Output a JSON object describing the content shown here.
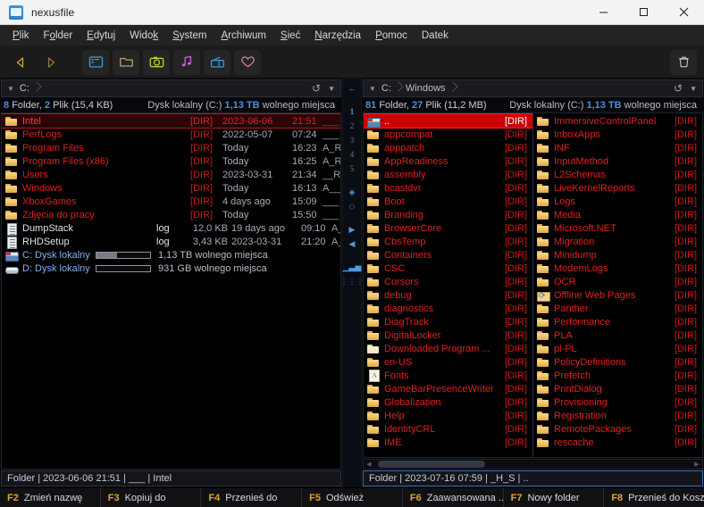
{
  "window": {
    "title": "nexusfile",
    "icon": "app-window-icon",
    "controls": {
      "minimize": "minimize-icon",
      "maximize": "maximize-icon",
      "close": "close-icon"
    }
  },
  "menubar": [
    {
      "label": "Plik",
      "accel": "P"
    },
    {
      "label": "Folder",
      "accel": "o"
    },
    {
      "label": "Edytuj",
      "accel": "E"
    },
    {
      "label": "Widok",
      "accel": "k"
    },
    {
      "label": "System",
      "accel": "S"
    },
    {
      "label": "Archiwum",
      "accel": "A"
    },
    {
      "label": "Sieć",
      "accel": "S"
    },
    {
      "label": "Narzędzia",
      "accel": "N"
    },
    {
      "label": "Pomoc",
      "accel": "P"
    },
    {
      "label": "Datek",
      "accel": ""
    }
  ],
  "toolbar": {
    "back": "back-arrow-icon",
    "forward": "forward-arrow-icon",
    "terminal": "terminal-icon",
    "folder": "folder-icon",
    "camera": "camera-icon",
    "music": "music-note-icon",
    "radio": "radio-icon",
    "favorites": "heart-icon",
    "trash": "trash-icon"
  },
  "rail": {
    "back": "left-arrow-icon",
    "tabs": [
      "1",
      "2",
      "3",
      "4",
      "5"
    ],
    "bookmark_filled": "diamond-filled-icon",
    "bookmark_empty": "diamond-outline-icon",
    "next": "play-right-icon",
    "prev": "play-left-icon",
    "chart": "bar-chart-icon",
    "grid": "grid-icon"
  },
  "left_pane": {
    "path": {
      "caret": "dropdown-caret-icon",
      "crumbs": [
        "C:"
      ],
      "refresh": "refresh-icon",
      "history": "history-caret-icon"
    },
    "stats": {
      "folders": "8",
      "folders_label": "Folder,",
      "files": "2",
      "files_label": "Plik (15,4 KB)"
    },
    "disk_info_prefix": "Dysk lokalny (C:)",
    "disk_info_size": "1,13 TB",
    "disk_info_suffix": "wolnego miejsca",
    "rows": [
      {
        "icon": "folder",
        "name": "Intel",
        "dir": "[DIR]",
        "date": "2023-06-06",
        "time": "21:51",
        "attr": "___",
        "selected": true
      },
      {
        "icon": "folder",
        "name": "PerfLogs",
        "dir": "[DIR]",
        "date": "2022-05-07",
        "time": "07:24",
        "attr": "___",
        "selected": false
      },
      {
        "icon": "folder",
        "name": "Program Files",
        "dir": "[DIR]",
        "date": "Today",
        "time": "16:23",
        "attr": "A_R_",
        "selected": false
      },
      {
        "icon": "folder",
        "name": "Program Files (x86)",
        "dir": "[DIR]",
        "date": "Today",
        "time": "16:25",
        "attr": "A_R_",
        "selected": false
      },
      {
        "icon": "folder",
        "name": "Users",
        "dir": "[DIR]",
        "date": "2023-03-31",
        "time": "21:34",
        "attr": "__R_",
        "selected": false
      },
      {
        "icon": "folder",
        "name": "Windows",
        "dir": "[DIR]",
        "date": "Today",
        "time": "16:13",
        "attr": "A___",
        "selected": false
      },
      {
        "icon": "folder",
        "name": "XboxGames",
        "dir": "[DIR]",
        "date": "4 days ago",
        "time": "15:09",
        "attr": "___",
        "selected": false
      },
      {
        "icon": "folder",
        "name": "Zdjęcia do pracy",
        "dir": "[DIR]",
        "date": "Today",
        "time": "15:50",
        "attr": "___",
        "selected": false
      },
      {
        "icon": "file",
        "name": "DumpStack",
        "type": "log",
        "size": "12,0 KB",
        "date": "19 days ago",
        "time": "09:10",
        "attr": "A___",
        "white": true
      },
      {
        "icon": "file",
        "name": "RHDSetup",
        "type": "log",
        "size": "3,43 KB",
        "date": "2023-03-31",
        "time": "21:20",
        "attr": "A___",
        "white": true
      }
    ],
    "drives": [
      {
        "icon": "drive",
        "name": "C: Dysk lokalny",
        "used_pct": 38,
        "free": "1,13 TB wolnego miejsca"
      },
      {
        "icon": "dvd",
        "name": "D: Dysk lokalny",
        "used_pct": 0,
        "free": "931 GB wolnego miejsca"
      }
    ],
    "status": "Folder  |  2023-06-06 21:51  |  ___  |  Intel"
  },
  "right_pane": {
    "path": {
      "caret": "dropdown-caret-icon",
      "crumbs": [
        "C:",
        "Windows"
      ],
      "refresh": "refresh-icon",
      "history": "history-caret-icon"
    },
    "stats": {
      "folders": "81",
      "folders_label": "Folder,",
      "files": "27",
      "files_label": "Plik (11,2 MB)"
    },
    "disk_info_prefix": "Dysk lokalny (C:)",
    "disk_info_size": "1,13 TB",
    "disk_info_suffix": "wolnego miejsca",
    "column_a": [
      {
        "icon": "up",
        "name": "..",
        "dir": "[DIR]",
        "selected": true
      },
      {
        "icon": "folder",
        "name": "appcompat",
        "dir": "[DIR]"
      },
      {
        "icon": "folder",
        "name": "apppatch",
        "dir": "[DIR]"
      },
      {
        "icon": "folder",
        "name": "AppReadiness",
        "dir": "[DIR]"
      },
      {
        "icon": "folder",
        "name": "assembly",
        "dir": "[DIR]"
      },
      {
        "icon": "folder",
        "name": "bcastdvr",
        "dir": "[DIR]"
      },
      {
        "icon": "folder",
        "name": "Boot",
        "dir": "[DIR]"
      },
      {
        "icon": "folder",
        "name": "Branding",
        "dir": "[DIR]"
      },
      {
        "icon": "folder",
        "name": "BrowserCore",
        "dir": "[DIR]"
      },
      {
        "icon": "folder",
        "name": "CbsTemp",
        "dir": "[DIR]"
      },
      {
        "icon": "folder",
        "name": "Containers",
        "dir": "[DIR]"
      },
      {
        "icon": "folder",
        "name": "CSC",
        "dir": "[DIR]"
      },
      {
        "icon": "folder",
        "name": "Cursors",
        "dir": "[DIR]"
      },
      {
        "icon": "folder",
        "name": "debug",
        "dir": "[DIR]"
      },
      {
        "icon": "folder",
        "name": "diagnostics",
        "dir": "[DIR]"
      },
      {
        "icon": "folder",
        "name": "DiagTrack",
        "dir": "[DIR]"
      },
      {
        "icon": "folder",
        "name": "DigitalLocker",
        "dir": "[DIR]"
      },
      {
        "icon": "folderpale",
        "name": "Downloaded Program ...",
        "dir": "[DIR]"
      },
      {
        "icon": "folder",
        "name": "en-US",
        "dir": "[DIR]"
      },
      {
        "icon": "fonts",
        "name": "Fonts",
        "dir": "[DIR]"
      },
      {
        "icon": "folder",
        "name": "GameBarPresenceWriter",
        "dir": "[DIR]"
      },
      {
        "icon": "folder",
        "name": "Globalization",
        "dir": "[DIR]"
      },
      {
        "icon": "folder",
        "name": "Help",
        "dir": "[DIR]"
      },
      {
        "icon": "folder",
        "name": "IdentityCRL",
        "dir": "[DIR]"
      },
      {
        "icon": "folder",
        "name": "IME",
        "dir": "[DIR]"
      }
    ],
    "column_b": [
      {
        "icon": "folder",
        "name": "ImmersiveControlPanel",
        "dir": "[DIR]"
      },
      {
        "icon": "folder",
        "name": "InboxApps",
        "dir": "[DIR]"
      },
      {
        "icon": "folder",
        "name": "INF",
        "dir": "[DIR]"
      },
      {
        "icon": "folder",
        "name": "InputMethod",
        "dir": "[DIR]"
      },
      {
        "icon": "folder",
        "name": "L2Schemas",
        "dir": "[DIR]"
      },
      {
        "icon": "folder",
        "name": "LiveKernelReports",
        "dir": "[DIR]"
      },
      {
        "icon": "folder",
        "name": "Logs",
        "dir": "[DIR]"
      },
      {
        "icon": "folder",
        "name": "Media",
        "dir": "[DIR]"
      },
      {
        "icon": "folder",
        "name": "Microsoft.NET",
        "dir": "[DIR]"
      },
      {
        "icon": "folder",
        "name": "Migration",
        "dir": "[DIR]"
      },
      {
        "icon": "folder",
        "name": "Minidump",
        "dir": "[DIR]"
      },
      {
        "icon": "folder",
        "name": "ModemLogs",
        "dir": "[DIR]"
      },
      {
        "icon": "folder",
        "name": "OCR",
        "dir": "[DIR]"
      },
      {
        "icon": "offline",
        "name": "Offline Web Pages",
        "dir": "[DIR]"
      },
      {
        "icon": "folder",
        "name": "Panther",
        "dir": "[DIR]"
      },
      {
        "icon": "folder",
        "name": "Performance",
        "dir": "[DIR]"
      },
      {
        "icon": "folder",
        "name": "PLA",
        "dir": "[DIR]"
      },
      {
        "icon": "folder",
        "name": "pl-PL",
        "dir": "[DIR]"
      },
      {
        "icon": "folder",
        "name": "PolicyDefinitions",
        "dir": "[DIR]"
      },
      {
        "icon": "folder",
        "name": "Prefetch",
        "dir": "[DIR]"
      },
      {
        "icon": "folder",
        "name": "PrintDialog",
        "dir": "[DIR]"
      },
      {
        "icon": "folder",
        "name": "Provisioning",
        "dir": "[DIR]"
      },
      {
        "icon": "folder",
        "name": "Registration",
        "dir": "[DIR]"
      },
      {
        "icon": "folder",
        "name": "RemotePackages",
        "dir": "[DIR]"
      },
      {
        "icon": "folder",
        "name": "rescache",
        "dir": "[DIR]"
      }
    ],
    "status": "Folder  |  2023-07-16 07:59  |  _H_S  |  .."
  },
  "function_keys": [
    {
      "key": "F2",
      "label": "Zmień nazwę"
    },
    {
      "key": "F3",
      "label": "Kopiuj do"
    },
    {
      "key": "F4",
      "label": "Przenieś do"
    },
    {
      "key": "F5",
      "label": "Odśwież"
    },
    {
      "key": "F6",
      "label": "Zaawansowana ..."
    },
    {
      "key": "F7",
      "label": "Nowy folder"
    },
    {
      "key": "F8",
      "label": "Przenieś do Kosza"
    }
  ],
  "colors": {
    "accent_blue": "#4a90d9",
    "dir_red": "#e02020",
    "selection_red": "#cc0000",
    "fn_key_amber": "#e0a62c"
  }
}
